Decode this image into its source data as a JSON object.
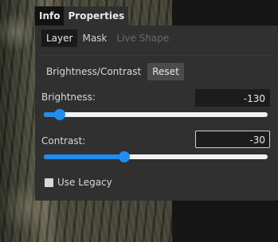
{
  "panel_tabs": [
    {
      "label": "Info",
      "active": false
    },
    {
      "label": "Properties",
      "active": true
    }
  ],
  "sub_tabs": [
    {
      "label": "Layer",
      "active": true
    },
    {
      "label": "Mask",
      "active": false
    },
    {
      "label": "Live Shape",
      "disabled": true
    }
  ],
  "adjustment": {
    "name": "Brightness/Contrast",
    "reset_label": "Reset"
  },
  "brightness": {
    "label": "Brightness:",
    "value": "-130",
    "slider_fraction": 0.07
  },
  "contrast": {
    "label": "Contrast:",
    "value": "-30",
    "slider_fraction": 0.36,
    "focused": true
  },
  "use_legacy": {
    "label": "Use Legacy",
    "checked": false
  },
  "colors": {
    "accent": "#1f8ef2",
    "panel": "#303030",
    "field": "#1c1c1c"
  }
}
